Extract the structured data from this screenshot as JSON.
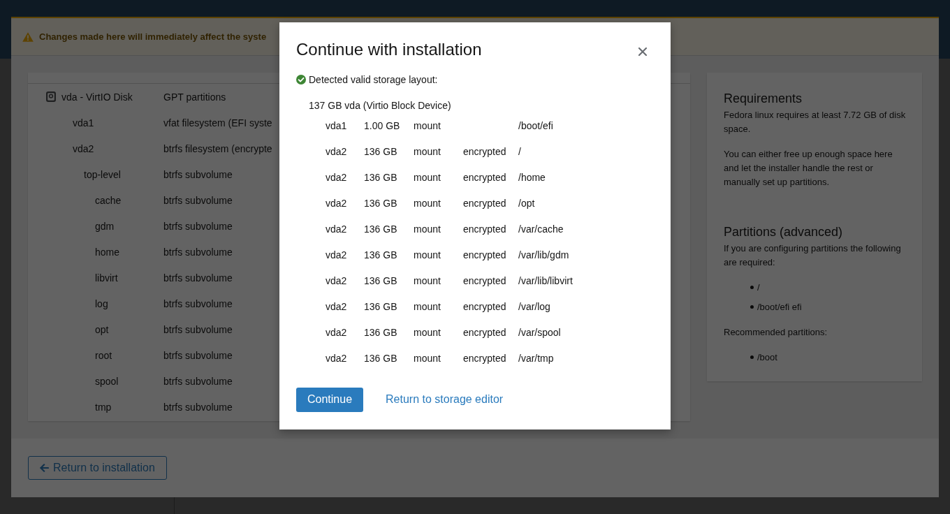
{
  "storage_editor": {
    "alert": {
      "title": "Changes made here will immediately affect the syste"
    },
    "table": {
      "rows": [
        {
          "id": "vda - VirtIO Disk",
          "type": "GPT partitions",
          "children": [
            {
              "id": "vda1",
              "type": "vfat filesystem (EFI syste"
            },
            {
              "id": "vda2",
              "type": "btrfs filesystem (encrypte",
              "children": [
                {
                  "id": "top-level",
                  "type": "btrfs subvolume",
                  "children": [
                    {
                      "id": "cache",
                      "type": "btrfs subvolume"
                    },
                    {
                      "id": "gdm",
                      "type": "btrfs subvolume"
                    },
                    {
                      "id": "home",
                      "type": "btrfs subvolume"
                    },
                    {
                      "id": "libvirt",
                      "type": "btrfs subvolume"
                    },
                    {
                      "id": "log",
                      "type": "btrfs subvolume"
                    },
                    {
                      "id": "opt",
                      "type": "btrfs subvolume"
                    },
                    {
                      "id": "root",
                      "type": "btrfs subvolume"
                    },
                    {
                      "id": "spool",
                      "type": "btrfs subvolume"
                    },
                    {
                      "id": "tmp",
                      "type": "btrfs subvolume"
                    }
                  ]
                }
              ]
            }
          ]
        }
      ]
    },
    "requirements": {
      "blocks": [
        {
          "kind": "heading",
          "text": "Requirements"
        },
        {
          "kind": "paragraph",
          "text": "Fedora linux requires at least 7.72 GB of disk space."
        },
        {
          "kind": "paragraph",
          "text": "You can either free up enough space here and let the installer handle the rest or manually set up partitions."
        },
        {
          "kind": "heading",
          "text": "Partitions (advanced)"
        },
        {
          "kind": "paragraph",
          "text": "If you are configuring partitions the following are required:"
        },
        {
          "kind": "list",
          "items": [
            "/",
            "/boot/efi efi"
          ]
        },
        {
          "kind": "paragraph",
          "text": "Recommended partitions:"
        },
        {
          "kind": "list",
          "items": [
            "/boot"
          ]
        }
      ]
    },
    "footer": {
      "button": "Return to installation"
    }
  },
  "dialog": {
    "title": "Continue with installation",
    "status": "Detected valid storage layout:",
    "device": "137 GB vda (Virtio Block Device)",
    "rows": [
      {
        "device": "vda1",
        "size": "1.00 GB",
        "action": "mount",
        "mountpoint": "/boot/efi"
      },
      {
        "device": "vda2",
        "size": "136 GB",
        "action": "mount",
        "encryption": "encrypted",
        "mountpoint": "/"
      },
      {
        "device": "vda2",
        "size": "136 GB",
        "action": "mount",
        "encryption": "encrypted",
        "mountpoint": "/home"
      },
      {
        "device": "vda2",
        "size": "136 GB",
        "action": "mount",
        "encryption": "encrypted",
        "mountpoint": "/opt"
      },
      {
        "device": "vda2",
        "size": "136 GB",
        "action": "mount",
        "encryption": "encrypted",
        "mountpoint": "/var/cache"
      },
      {
        "device": "vda2",
        "size": "136 GB",
        "action": "mount",
        "encryption": "encrypted",
        "mountpoint": "/var/lib/gdm"
      },
      {
        "device": "vda2",
        "size": "136 GB",
        "action": "mount",
        "encryption": "encrypted",
        "mountpoint": "/var/lib/libvirt"
      },
      {
        "device": "vda2",
        "size": "136 GB",
        "action": "mount",
        "encryption": "encrypted",
        "mountpoint": "/var/log"
      },
      {
        "device": "vda2",
        "size": "136 GB",
        "action": "mount",
        "encryption": "encrypted",
        "mountpoint": "/var/spool"
      },
      {
        "device": "vda2",
        "size": "136 GB",
        "action": "mount",
        "encryption": "encrypted",
        "mountpoint": "/var/tmp"
      }
    ],
    "actions": [
      {
        "kind": "primary",
        "label": "Continue"
      },
      {
        "kind": "link",
        "label": "Return to storage editor"
      }
    ]
  }
}
